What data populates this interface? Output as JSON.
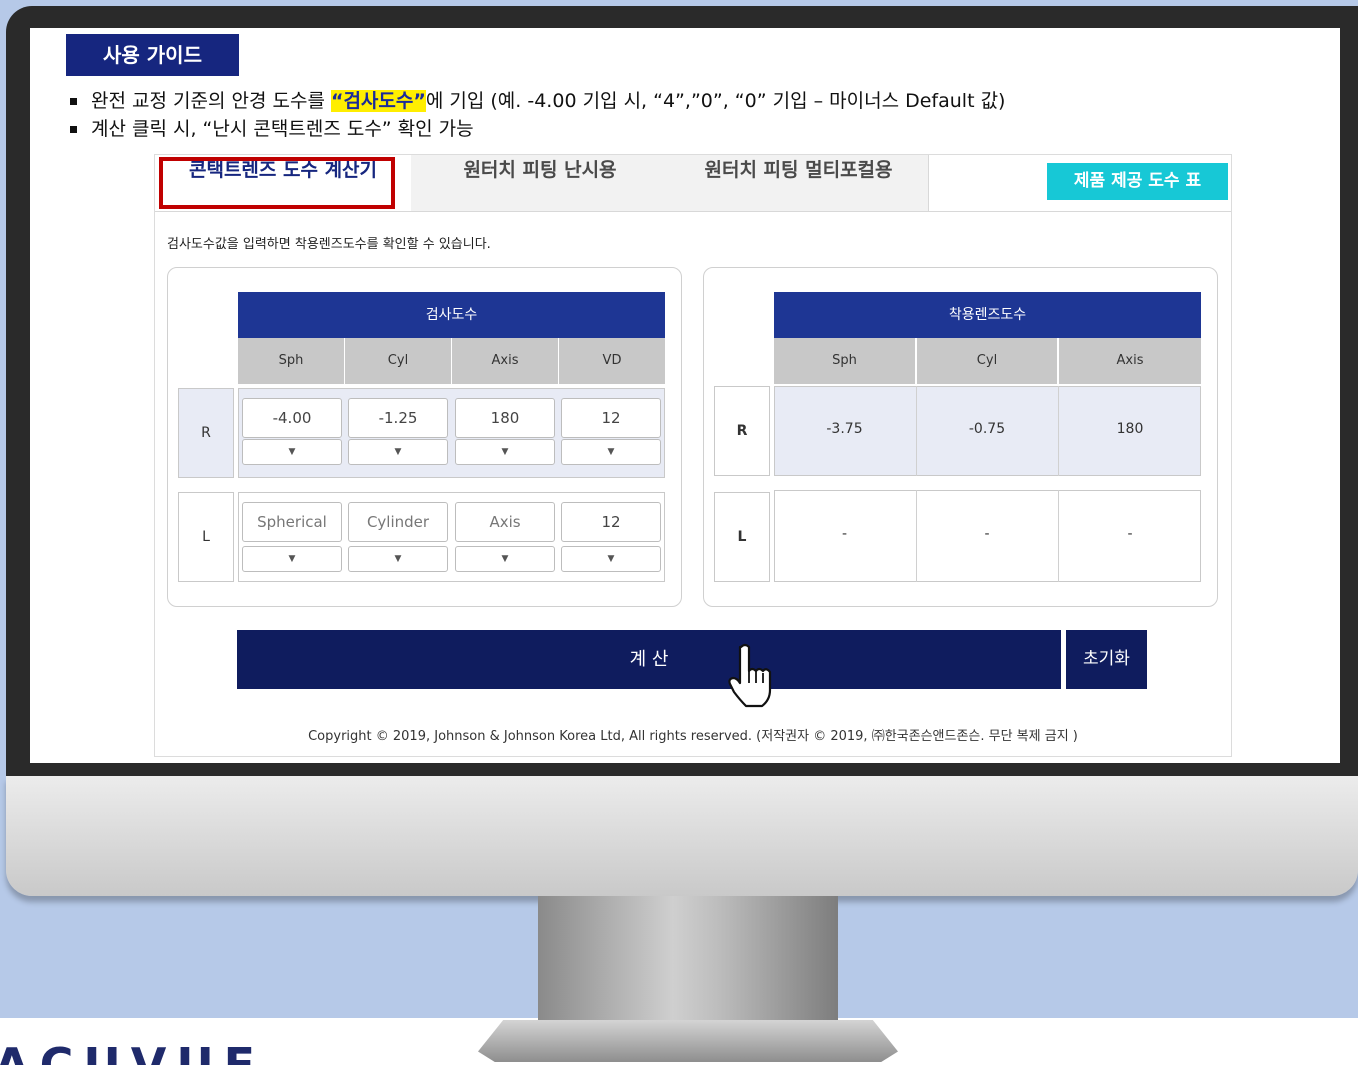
{
  "guide": {
    "title": "사용 가이드",
    "bullet1_prefix": "완전 교정 기준의 안경 도수를 ",
    "bullet1_highlight": "“검사도수”",
    "bullet1_suffix": "에  기입 (예. -4.00 기입 시, “4”,”0”, “0” 기입 – 마이너스 Default 값)",
    "bullet2": "계산 클릭 시, “난시 콘택트렌즈 도수” 확인 가능"
  },
  "tabs": [
    "콘택트렌즈 도수 계산기",
    "원터치 피팅 난시용",
    "원터치 피팅 멀티포컬용"
  ],
  "product_table_button": "제품 제공 도수 표",
  "description": "검사도수값을 입력하면 착용렌즈도수를 확인할 수 있습니다.",
  "exam": {
    "header": "검사도수",
    "columns": [
      "Sph",
      "Cyl",
      "Axis",
      "VD"
    ],
    "rows": [
      {
        "label": "R",
        "values": [
          "-4.00",
          "-1.25",
          "180",
          "12"
        ]
      },
      {
        "label": "L",
        "placeholders": [
          "Spherical",
          "Cylinder",
          "Axis"
        ],
        "vd": "12"
      }
    ],
    "dropdown_arrow": "▼"
  },
  "lens": {
    "header": "착용렌즈도수",
    "columns": [
      "Sph",
      "Cyl",
      "Axis"
    ],
    "rows": [
      {
        "label": "R",
        "values": [
          "-3.75",
          "-0.75",
          "180"
        ]
      },
      {
        "label": "L",
        "values": [
          "-",
          "-",
          "-"
        ]
      }
    ]
  },
  "calculate_label": "계 산",
  "reset_label": "초기화",
  "copyright": "Copyright © 2019, Johnson & Johnson Korea Ltd, All rights reserved. (저작권자 © 2019, ㈜한국존슨앤드존슨. 무단 복제 금지 )",
  "logo_fragment": "ACUVUE",
  "colors": {
    "navy": "#16267f",
    "header_blue": "#1e3694",
    "cyan": "#17c8d6",
    "highlight": "#ffee00",
    "tab_outline": "#c00000"
  }
}
